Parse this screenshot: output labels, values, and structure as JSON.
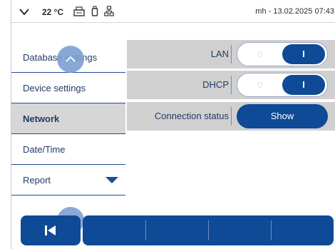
{
  "status_bar": {
    "temperature": "22 °C",
    "user_datetime": "mh - 13.02.2025 07:43",
    "icons": [
      "chevron-down-icon",
      "printer-icon",
      "usb-icon",
      "network-icon"
    ]
  },
  "sidebar": {
    "items": [
      {
        "label": "Database settings",
        "active": false
      },
      {
        "label": "Device settings",
        "active": false
      },
      {
        "label": "Network",
        "active": true
      },
      {
        "label": "Date/Time",
        "active": false
      },
      {
        "label": "Report",
        "active": false,
        "dropdown": true
      }
    ]
  },
  "settings": {
    "lan": {
      "label": "LAN",
      "off_label": "0",
      "on_label": "I",
      "state": "on"
    },
    "dhcp": {
      "label": "DHCP",
      "off_label": "0",
      "on_label": "I",
      "state": "on"
    },
    "connection_status": {
      "label": "Connection status",
      "button_label": "Show"
    }
  },
  "colors": {
    "accent": "#0e4a96",
    "panel_row": "#d0d0d0",
    "scroll_button": "#7d9fd1"
  }
}
